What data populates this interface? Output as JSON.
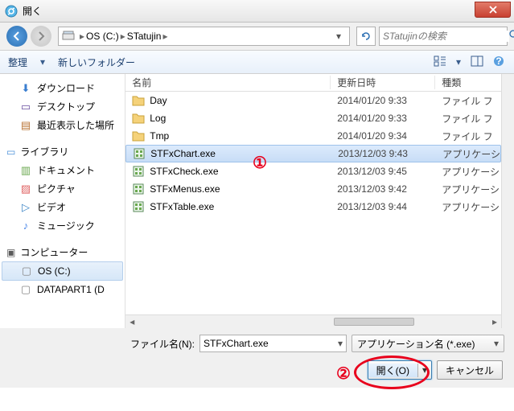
{
  "window": {
    "title": "開く"
  },
  "nav": {
    "crumb_drive": "OS (C:)",
    "crumb_folder": "STatujin",
    "search_placeholder": "STatujinの検索"
  },
  "toolbar": {
    "organize": "整理",
    "new_folder": "新しいフォルダー"
  },
  "sidebar": {
    "favorites": [
      "ダウンロード",
      "デスクトップ",
      "最近表示した場所"
    ],
    "libraries_head": "ライブラリ",
    "libraries": [
      "ドキュメント",
      "ピクチャ",
      "ビデオ",
      "ミュージック"
    ],
    "computer_head": "コンピューター",
    "drives": [
      "OS (C:)",
      "DATAPART1 (D"
    ]
  },
  "columns": {
    "name": "名前",
    "date": "更新日時",
    "type": "種類"
  },
  "files": [
    {
      "name": "Day",
      "date": "2014/01/20 9:33",
      "type": "ファイル フ",
      "icon": "folder"
    },
    {
      "name": "Log",
      "date": "2014/01/20 9:33",
      "type": "ファイル フ",
      "icon": "folder"
    },
    {
      "name": "Tmp",
      "date": "2014/01/20 9:34",
      "type": "ファイル フ",
      "icon": "folder"
    },
    {
      "name": "STFxChart.exe",
      "date": "2013/12/03 9:43",
      "type": "アプリケーシ",
      "icon": "exe",
      "selected": true
    },
    {
      "name": "STFxCheck.exe",
      "date": "2013/12/03 9:45",
      "type": "アプリケーシ",
      "icon": "exe"
    },
    {
      "name": "STFxMenus.exe",
      "date": "2013/12/03 9:42",
      "type": "アプリケーシ",
      "icon": "exe"
    },
    {
      "name": "STFxTable.exe",
      "date": "2013/12/03 9:44",
      "type": "アプリケーシ",
      "icon": "exe"
    }
  ],
  "filename": {
    "label": "ファイル名(N):",
    "value": "STFxChart.exe"
  },
  "filter": {
    "value": "アプリケーション名 (*.exe)"
  },
  "buttons": {
    "open": "開く(O)",
    "cancel": "キャンセル"
  },
  "annotations": {
    "one": "①",
    "two": "②"
  }
}
